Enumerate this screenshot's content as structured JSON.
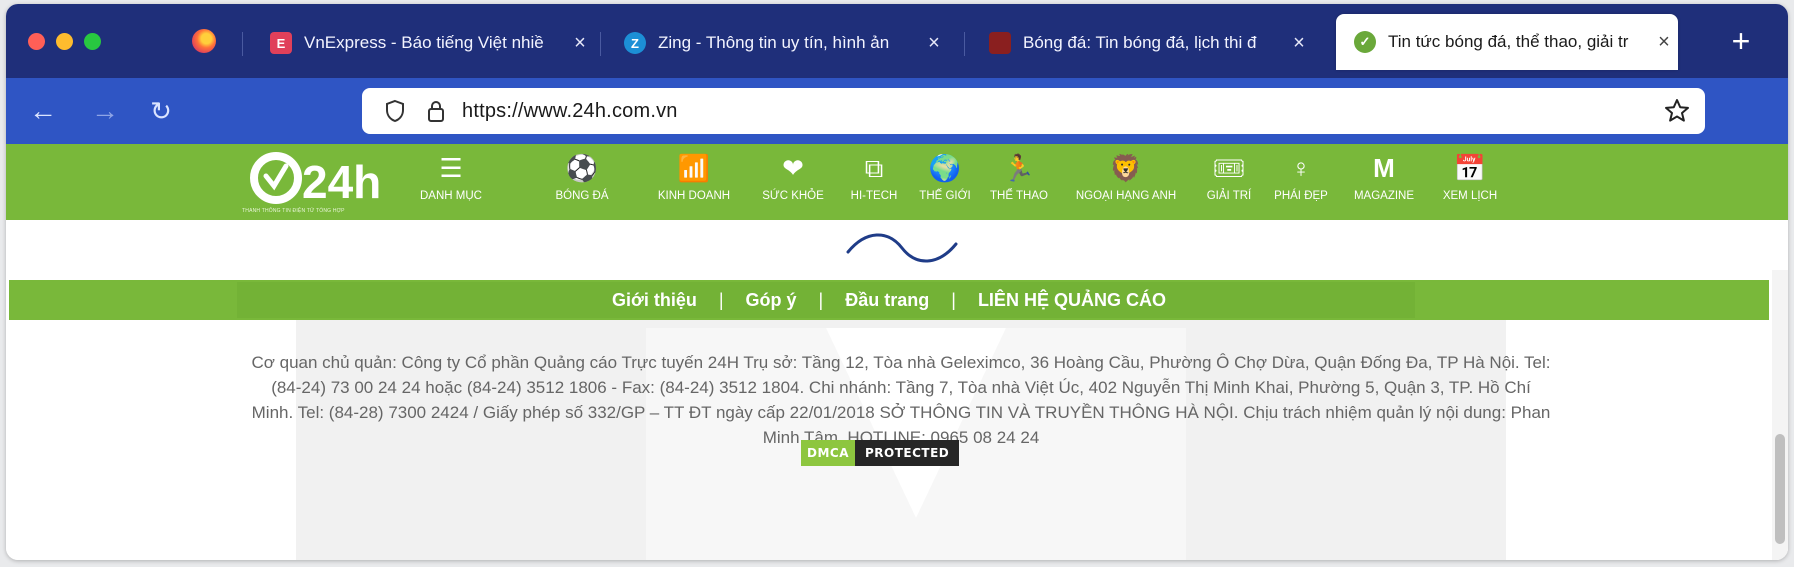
{
  "browser": {
    "tabs": [
      {
        "title": "VnExpress - Báo tiếng Việt nhiề",
        "favicon": "vnexpress-favicon",
        "favicon_color": "#e0405a",
        "favicon_glyph": "E"
      },
      {
        "title": "Zing - Thông tin uy tín, hình ản",
        "favicon": "zing-favicon",
        "favicon_color": "#1c8fd6",
        "favicon_glyph": "Z"
      },
      {
        "title": "Bóng đá: Tin bóng đá, lịch thi đ",
        "favicon": "bongda-favicon",
        "favicon_color": "#8a1f1f",
        "favicon_glyph": ""
      },
      {
        "title": "Tin tức bóng đá, thể thao, giải tr",
        "favicon": "24h-favicon",
        "favicon_color": "#6aa83a",
        "favicon_glyph": "✓",
        "active": true
      }
    ],
    "new_tab": "+",
    "close_glyph": "×",
    "url": "https://www.24h.com.vn"
  },
  "site": {
    "logo_text": "24h",
    "logo_tagline": "THANH THÔNG TIN ĐIỆN TỬ TỔNG HỢP",
    "menu": [
      {
        "label": "DANH MỤC",
        "icon": "hamburger-icon",
        "glyph": "☰"
      },
      {
        "label": "BÓNG ĐÁ",
        "icon": "soccer-ball-icon",
        "glyph": "⚽"
      },
      {
        "label": "KINH DOANH",
        "icon": "bar-chart-icon",
        "glyph": "📶"
      },
      {
        "label": "SỨC KHỎE",
        "icon": "heart-pulse-icon",
        "glyph": "❤"
      },
      {
        "label": "HI-TECH",
        "icon": "devices-icon",
        "glyph": "⧉"
      },
      {
        "label": "THẾ GIỚI",
        "icon": "globe-icon",
        "glyph": "🌍"
      },
      {
        "label": "THỂ THAO",
        "icon": "runner-icon",
        "glyph": "🏃"
      },
      {
        "label": "NGOẠI HẠNG ANH",
        "icon": "lion-icon",
        "glyph": "🦁"
      },
      {
        "label": "GIẢI TRÍ",
        "icon": "movie-ticket-icon",
        "glyph": "🎟"
      },
      {
        "label": "PHÁI ĐẸP",
        "icon": "woman-icon",
        "glyph": "♀"
      },
      {
        "label": "MAGAZINE",
        "icon": "magazine-m-icon",
        "glyph": "M"
      },
      {
        "label": "XEM LỊCH",
        "icon": "calendar-icon",
        "glyph": "📅"
      }
    ],
    "footer_links": [
      "Giới thiệu",
      "Góp ý",
      "Đầu trang",
      "LIÊN HỆ QUẢNG CÁO"
    ],
    "footer_separator": "|",
    "address_lines": [
      "Cơ quan chủ quản: Công ty Cổ phần Quảng cáo Trực tuyến 24H Trụ sở: Tầng 12, Tòa nhà Geleximco, 36 Hoàng Cầu, Phường Ô Chợ Dừa, Quận Đống Đa, TP Hà Nội. Tel:",
      "(84-24) 73 00 24 24 hoặc (84-24) 3512 1806 - Fax: (84-24) 3512 1804. Chi nhánh: Tầng 7, Tòa nhà Việt Úc, 402 Nguyễn Thị Minh Khai, Phường 5, Quận 3, TP. Hồ Chí",
      "Minh. Tel: (84-28) 7300 2424 / Giấy phép số 332/GP – TT ĐT ngày cấp 22/01/2018 SỞ THÔNG TIN VÀ TRUYỀN THÔNG HÀ NỘI. Chịu trách nhiệm quản lý nội dung: Phan",
      "Minh Tâm. HOTLINE: 0965 08 24 24"
    ],
    "badge": {
      "left": "DMCA",
      "right": "PROTECTED"
    }
  },
  "colors": {
    "tabstrip": "#1f2f7a",
    "navbar": "#2f55c4",
    "brand_green": "#79b83a"
  }
}
